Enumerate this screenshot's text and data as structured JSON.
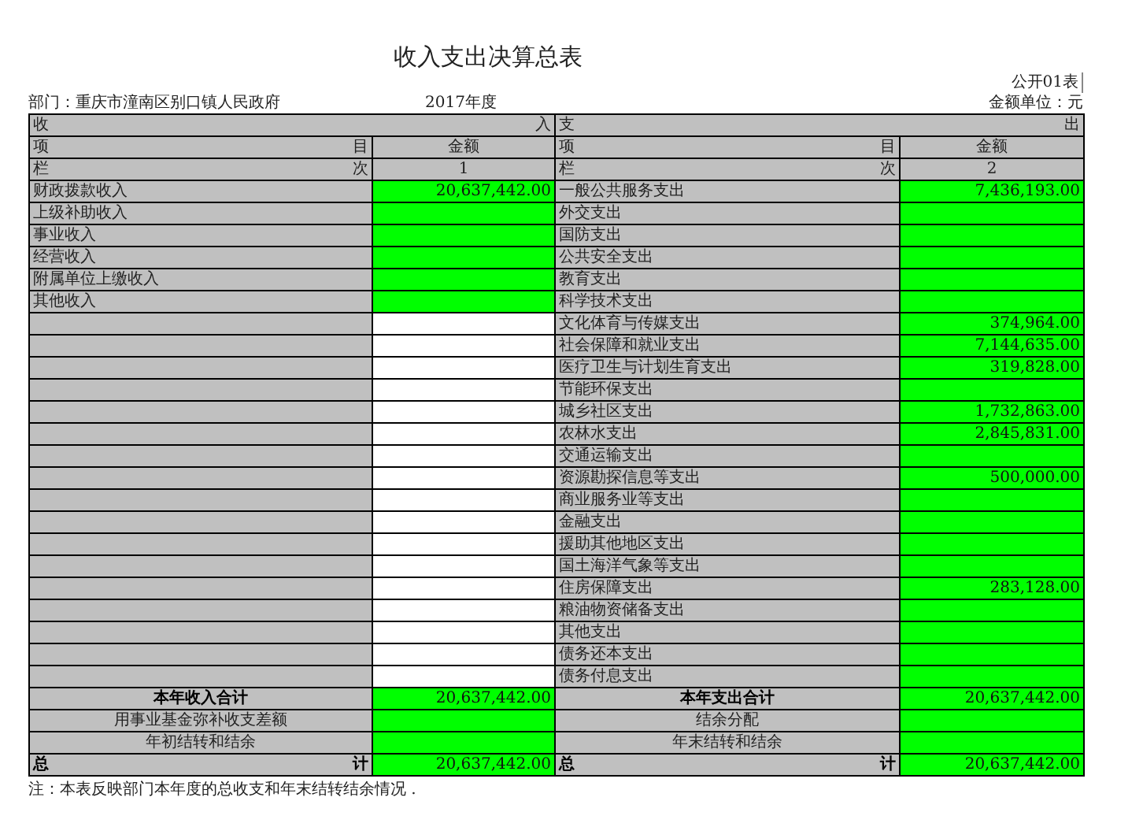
{
  "title": "收入支出决算总表",
  "form_no": "公开01表",
  "department": "部门：重庆市潼南区别口镇人民政府",
  "year": "2017年度",
  "unit": "金额单位：元",
  "header": [
    {
      "kind": "span",
      "left": [
        "收",
        "入"
      ],
      "right": [
        "支",
        "出"
      ]
    },
    {
      "kind": "split",
      "left": [
        "项",
        "目"
      ],
      "left_amount": "金额",
      "right": [
        "项",
        "目"
      ],
      "right_amount": "金额"
    },
    {
      "kind": "split",
      "left": [
        "栏",
        "次"
      ],
      "left_amount": "1",
      "right": [
        "栏",
        "次"
      ],
      "right_amount": "2"
    }
  ],
  "income": [
    {
      "label": "财政拨款收入",
      "amount": "20,637,442.00"
    },
    {
      "label": "上级补助收入"
    },
    {
      "label": "事业收入"
    },
    {
      "label": "经营收入"
    },
    {
      "label": "附属单位上缴收入"
    },
    {
      "label": "其他收入"
    }
  ],
  "expenditure": [
    {
      "label": "一般公共服务支出",
      "amount": "7,436,193.00"
    },
    {
      "label": "外交支出"
    },
    {
      "label": "国防支出"
    },
    {
      "label": "公共安全支出"
    },
    {
      "label": "教育支出"
    },
    {
      "label": "科学技术支出"
    },
    {
      "label": "文化体育与传媒支出",
      "amount": "374,964.00"
    },
    {
      "label": "社会保障和就业支出",
      "amount": "7,144,635.00"
    },
    {
      "label": "医疗卫生与计划生育支出",
      "amount": "319,828.00"
    },
    {
      "label": "节能环保支出"
    },
    {
      "label": "城乡社区支出",
      "amount": "1,732,863.00"
    },
    {
      "label": "农林水支出",
      "amount": "2,845,831.00"
    },
    {
      "label": "交通运输支出"
    },
    {
      "label": "资源勘探信息等支出",
      "amount": "500,000.00"
    },
    {
      "label": "商业服务业等支出"
    },
    {
      "label": "金融支出"
    },
    {
      "label": "援助其他地区支出"
    },
    {
      "label": "国土海洋气象等支出"
    },
    {
      "label": "住房保障支出",
      "amount": "283,128.00"
    },
    {
      "label": "粮油物资储备支出"
    },
    {
      "label": "其他支出"
    },
    {
      "label": "债务还本支出"
    },
    {
      "label": "债务付息支出"
    }
  ],
  "summary": [
    {
      "kind": "bold",
      "left_label": [
        "本年收入合计"
      ],
      "left_amount": "20,637,442.00",
      "right_label": [
        "本年支出合计"
      ],
      "right_amount": "20,637,442.00"
    },
    {
      "kind": "plain",
      "left_label": [
        "用事业基金弥补收支差额"
      ],
      "right_label": [
        "结余分配"
      ]
    },
    {
      "kind": "plain",
      "left_label": [
        "年初结转和结余"
      ],
      "right_label": [
        "年末结转和结余"
      ]
    },
    {
      "kind": "split",
      "left_label": [
        "总",
        "计"
      ],
      "left_amount": "20,637,442.00",
      "right_label": [
        "总",
        "计"
      ],
      "right_amount": "20,637,442.00"
    }
  ],
  "note": "注：本表反映部门本年度的总收支和年末结转结余情况 ."
}
